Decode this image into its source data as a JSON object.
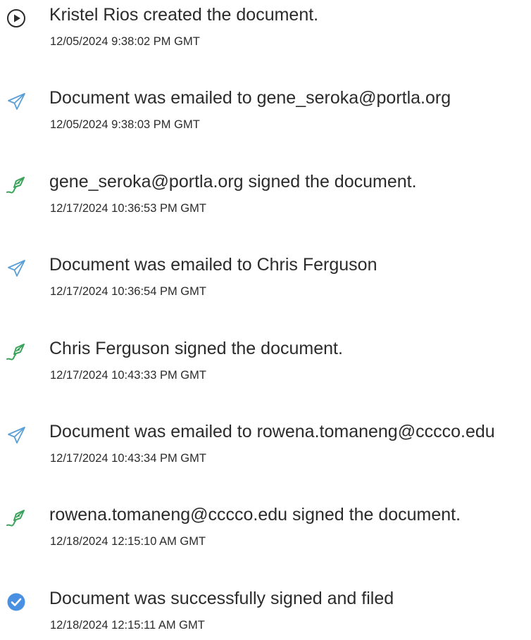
{
  "events": [
    {
      "icon": "play-circle-icon",
      "text": "Kristel Rios created the document.",
      "time": "12/05/2024 9:38:02 PM GMT"
    },
    {
      "icon": "paper-plane-icon",
      "text": "Document was emailed to gene_seroka@portla.org",
      "time": "12/05/2024 9:38:03 PM GMT"
    },
    {
      "icon": "pen-nib-icon",
      "text": "gene_seroka@portla.org signed the document.",
      "time": "12/17/2024 10:36:53 PM GMT"
    },
    {
      "icon": "paper-plane-icon",
      "text": "Document was emailed to Chris Ferguson",
      "time": "12/17/2024 10:36:54 PM GMT"
    },
    {
      "icon": "pen-nib-icon",
      "text": "Chris Ferguson signed the document.",
      "time": "12/17/2024 10:43:33 PM GMT"
    },
    {
      "icon": "paper-plane-icon",
      "text": "Document was emailed to rowena.tomaneng@cccco.edu",
      "time": "12/17/2024 10:43:34 PM GMT"
    },
    {
      "icon": "pen-nib-icon",
      "text": "rowena.tomaneng@cccco.edu signed the document.",
      "time": "12/18/2024 12:15:10 AM GMT"
    },
    {
      "icon": "check-circle-icon",
      "text": "Document was successfully signed and filed",
      "time": "12/18/2024 12:15:11 AM GMT"
    }
  ],
  "colors": {
    "text": "#2b2b2b",
    "send_icon": "#5aa0d6",
    "sign_icon": "#3ba35a",
    "complete_icon": "#4a90e2"
  }
}
